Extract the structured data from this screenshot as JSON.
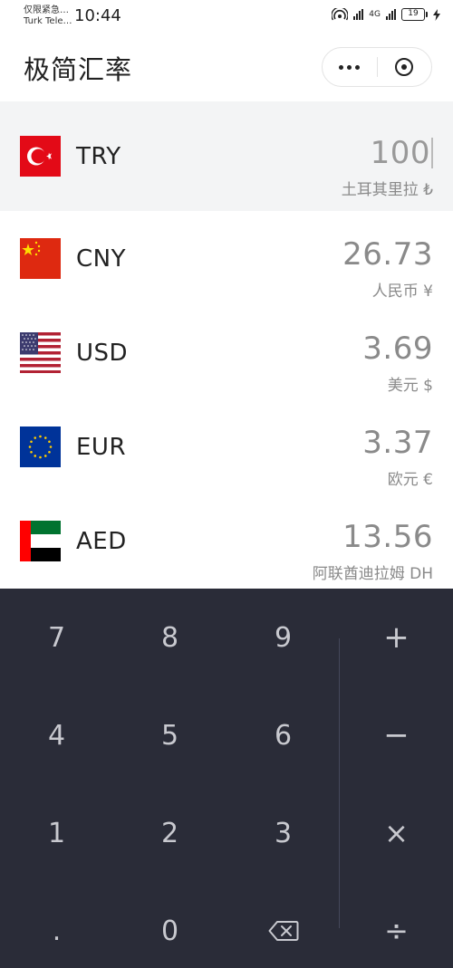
{
  "status_bar": {
    "carrier_line1": "仅限紧急…",
    "carrier_line2": "Turk Tele…",
    "time": "10:44",
    "network": "4G",
    "battery": "19"
  },
  "header": {
    "title": "极简汇率"
  },
  "currencies": [
    {
      "code": "TRY",
      "amount": "100",
      "name": "土耳其里拉 ₺",
      "active": true
    },
    {
      "code": "CNY",
      "amount": "26.73",
      "name": "人民币 ¥"
    },
    {
      "code": "USD",
      "amount": "3.69",
      "name": "美元 $"
    },
    {
      "code": "EUR",
      "amount": "3.37",
      "name": "欧元 €"
    },
    {
      "code": "AED",
      "amount": "13.56",
      "name": "阿联酋迪拉姆 DH"
    }
  ],
  "keypad": {
    "digits": [
      "7",
      "8",
      "9",
      "4",
      "5",
      "6",
      "1",
      "2",
      "3",
      "0"
    ],
    "ops": [
      "+",
      "−",
      "×",
      "÷"
    ],
    "decimal": "."
  },
  "colors": {
    "keypad_bg": "#2a2c38",
    "active_row_bg": "#f3f4f5",
    "amount_text": "#8a8a8a"
  }
}
